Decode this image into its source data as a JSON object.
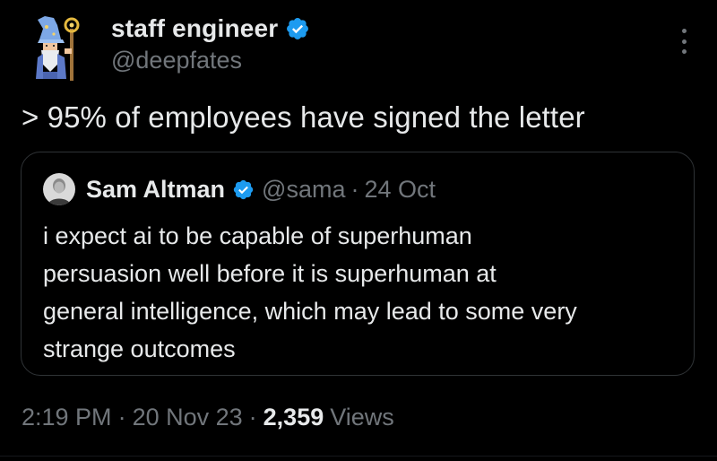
{
  "tweet": {
    "author": {
      "name": "staff engineer",
      "handle": "@deepfates",
      "avatar_icon": "wizard-avatar-icon",
      "verified": true
    },
    "text": "> 95% of employees have signed the letter",
    "more_icon": "more-options-icon",
    "quoted": {
      "name": "Sam Altman",
      "handle": "@sama",
      "separator": "·",
      "date": "24 Oct",
      "verified": true,
      "lines": [
        "i expect ai to be capable of superhuman",
        "persuasion well before it is superhuman at",
        "general intelligence, which may lead to some very",
        "strange outcomes"
      ]
    },
    "footer": {
      "time": "2:19 PM",
      "separator": "·",
      "date": "20 Nov 23",
      "views_count": "2,359",
      "views_label": "Views"
    }
  },
  "colors": {
    "background": "#000000",
    "primary_text": "#e7e9ea",
    "secondary_text": "#71767b",
    "verified_badge": "#1d9bf0",
    "border": "#2f3336"
  }
}
